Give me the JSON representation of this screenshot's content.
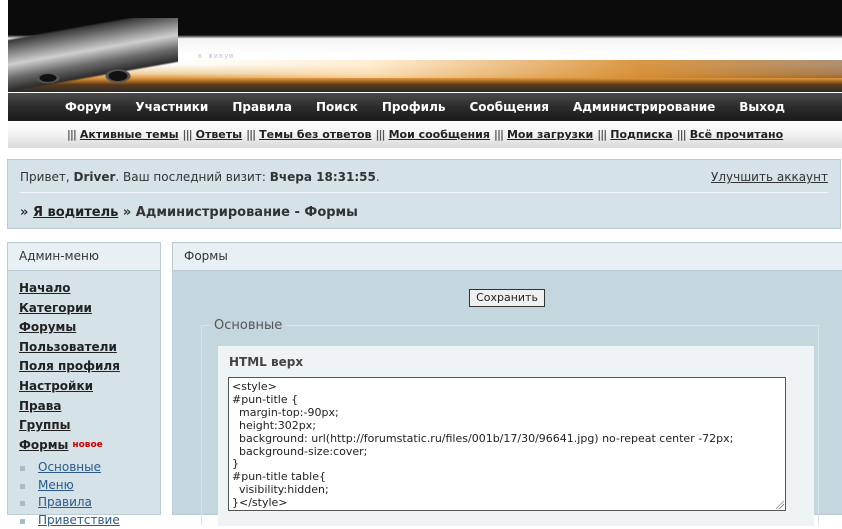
{
  "banner": {
    "watermark": "в живую"
  },
  "main_nav": [
    "Форум",
    "Участники",
    "Правила",
    "Поиск",
    "Профиль",
    "Сообщения",
    "Администрирование",
    "Выход"
  ],
  "sub_nav": {
    "separator": "|||",
    "items": [
      "Активные темы",
      "Ответы",
      "Темы без ответов",
      "Мои сообщения",
      "Мои загрузки",
      "Подписка",
      "Всё прочитано"
    ]
  },
  "welcome": {
    "greeting": "Привет,",
    "username": "Driver",
    "last_visit_label": ". Ваш последний визит:",
    "last_visit_value": "Вчера 18:31:55",
    "period": ".",
    "upgrade_link": "Улучшить аккаунт"
  },
  "breadcrumbs": {
    "prefix": "»",
    "link": "Я водитель",
    "rest": "» Администрирование - Формы"
  },
  "admin_menu": {
    "title": "Админ-меню",
    "items": [
      "Начало",
      "Категории",
      "Форумы",
      "Пользователи",
      "Поля профиля",
      "Настройки",
      "Права",
      "Группы"
    ],
    "active_item": "Формы",
    "new_badge": "новое",
    "subitems": [
      "Основные",
      "Меню",
      "Правила",
      "Приветствие"
    ]
  },
  "forms_panel": {
    "title": "Формы",
    "save_button": "Сохранить",
    "fieldset_legend": "Основные",
    "html_label": "HTML верх",
    "code": "<style>\n#pun-title {\n  margin-top:-90px;\n  height:302px;\n  background: url(http://forumstatic.ru/files/001b/17/30/96641.jpg) no-repeat center -72px;\n  background-size:cover;\n}\n#pun-title table{\n  visibility:hidden;\n}</style>"
  },
  "colors": {
    "panel_bg": "#d5e2e8",
    "nav_bg": "#2c2c2c",
    "badge_red": "#cc0000"
  }
}
